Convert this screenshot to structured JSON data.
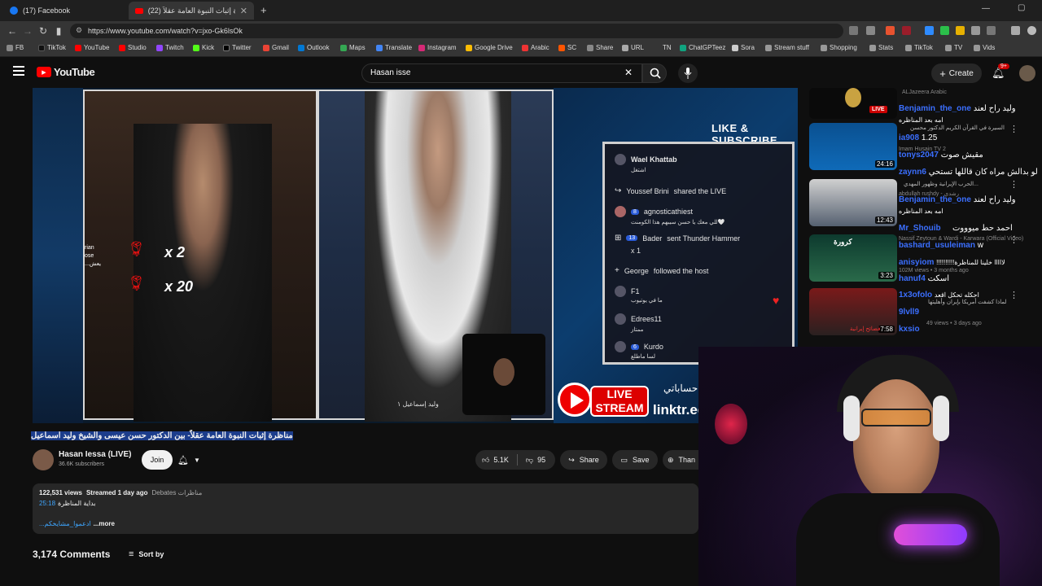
{
  "browser": {
    "tabs": [
      {
        "title": "(17) Facebook",
        "active": false
      },
      {
        "title": "(22) مناظرة إثبات النبوة العامة عقلاً",
        "active": true
      }
    ],
    "url": "https://www.youtube.com/watch?v=jxo-Gk6lsOk",
    "bookmarks": [
      "FB",
      "TikTok",
      "YouTube",
      "Studio",
      "Twitch",
      "Kick",
      "Twitter",
      "Gmail",
      "Outlook",
      "Maps",
      "Translate",
      "Instagram",
      "Google Drive",
      "Arabic",
      "SC",
      "Share",
      "URL",
      "TN",
      "ChatGPTeez",
      "Sora",
      "Stream stuff",
      "Shopping",
      "Stats",
      "TikTok",
      "TV",
      "Vids"
    ]
  },
  "youtube": {
    "logo": "YouTube",
    "search_value": "Hasan isse",
    "create_label": "Create",
    "notifications_badge": "9+"
  },
  "video_overlay": {
    "like_subscribe": "LIKE & SUBSCRIBE",
    "rose_x2": "x 2",
    "rose_x20": "x 20",
    "left_names": [
      "rian",
      "ose",
      "...يعش"
    ],
    "nameplate": "وليد إسماعيل ١",
    "live_stream_top": "LIVE",
    "live_stream_bottom": "STREAM",
    "linktree": "linktr.ee",
    "accounts": "حساباتي",
    "chat": [
      {
        "user": "Wael Khattab",
        "msg": "اشتغل"
      },
      {
        "user": "Youssef Brini",
        "msg": "shared the LIVE"
      },
      {
        "user": "agnosticathiest",
        "level": "8",
        "msg": "للي معك يا حسن سيبهم هذا الكومنت🤍"
      },
      {
        "user": "Bader",
        "level": "13",
        "msg": "sent Thunder Hammer",
        "extra": "x 1"
      },
      {
        "user": "George",
        "msg": "followed the host"
      },
      {
        "user": "F1",
        "msg": "ما في يوتيوب"
      },
      {
        "user": "Edrees11",
        "msg": "ممتاز"
      },
      {
        "user": "Kurdo",
        "level": "6",
        "msg": "لسا ماطلع"
      }
    ]
  },
  "watch": {
    "title": "مناظرة إثبات النبوة العامة عقلاً- بين الدكتور حسن عيسى والشيخ وليد اسماعيل",
    "channel_name": "Hasan Iessa (LIVE)",
    "subscribers": "36.6K subscribers",
    "join_label": "Join",
    "likes": "5.1K",
    "dislikes": "95",
    "share_label": "Share",
    "save_label": "Save",
    "thanks_label": "Than",
    "views": "122,531 views",
    "streamed": "Streamed 1 day ago",
    "category": "Debates مناظرات",
    "timestamp": "25:18",
    "timestamp_label": "بداية المناظرة",
    "desc_tag": "...ادعموا_مشايخكم",
    "more": "...more",
    "comments_count": "3,174 Comments",
    "sort_label": "Sort by"
  },
  "sidebar": {
    "recommendations": [
      {
        "duration": "",
        "live_label": "LIVE",
        "channel": "ALJazeera Arabic"
      },
      {
        "duration": "24:16",
        "title": "السيرة في القرآن الكريم الدكتور محسن",
        "channel": "Imam Husain TV 2"
      },
      {
        "duration": "12:43",
        "title": "الحرب الإيرانية وظهور المهدي...",
        "channel": "abdullah rushdy - رشدي"
      },
      {
        "duration": "3:23",
        "title": "كرورة",
        "channel": "Nassif Zeytoun & Wardi - Karwara (Official Video)",
        "meta": "102M views • 3 months ago"
      },
      {
        "duration": "7:58",
        "title": "لماذا كشفت أمريكا بإيران وأهليتها",
        "channel": "فضائح إيرانية",
        "meta": "49 views • 3 days ago"
      }
    ]
  },
  "stream_chat": [
    {
      "nick": "Benjamin_the_one",
      "msg": "وليد راح لعند"
    },
    {
      "nick": "",
      "msg": "امه بعد المناظره"
    },
    {
      "nick": "ia908",
      "msg": "1.25"
    },
    {
      "nick": "tonys2047",
      "msg": "مقيش صوت"
    },
    {
      "nick": "zaynn6",
      "msg": "لو بدالش مراه كان قاللها تستحي"
    },
    {
      "nick": "Benjamin_the_one",
      "msg": "وليد راح لعند"
    },
    {
      "nick": "",
      "msg": "امه بعد المناظره"
    },
    {
      "nick": "",
      "msg": "احمد حط ميوووت"
    },
    {
      "nick": "Mr_Shouib",
      "msg": ""
    },
    {
      "nick": "bashard_usuleiman",
      "msg": "w"
    },
    {
      "nick": "anisyiom",
      "msg": "!!!!!!!!!!لااااا خلينا للمناظرة"
    },
    {
      "nick": "hanuf4",
      "msg": "اسكت"
    },
    {
      "nick": "1x3ofolo",
      "msg": "احكله تحكل اقعد"
    },
    {
      "nick": "9lvll9",
      "msg": ""
    },
    {
      "nick": "kxsio",
      "msg": ""
    }
  ],
  "colors": {
    "accent_blue": "#3ea6ff",
    "chat_nick": "#3b6fff",
    "live_red": "#ff0000",
    "highlight": "#1c3d8c"
  }
}
